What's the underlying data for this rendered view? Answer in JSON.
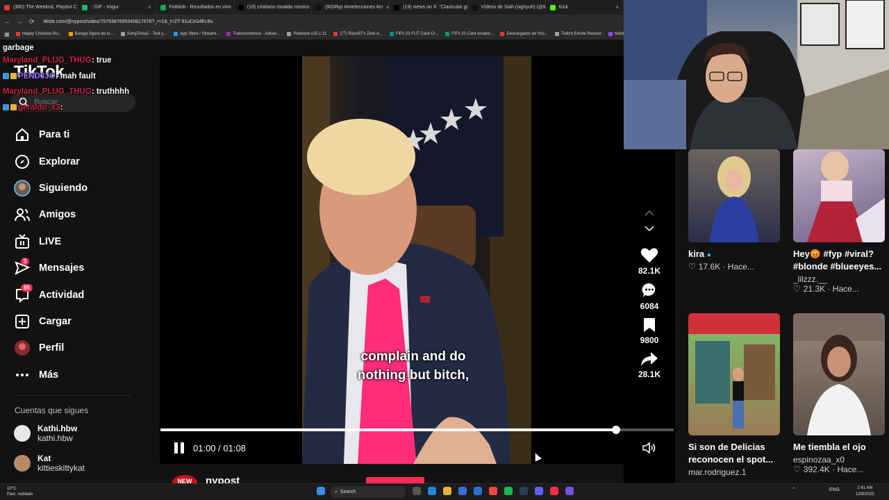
{
  "browser": {
    "tabs": [
      {
        "label": "(380) The Weeknd, Playboi Ca",
        "color": "#e53935"
      },
      {
        "label": "- GIF - Imgur",
        "color": "#1bb76e"
      },
      {
        "label": "FotMob - Resultados en vivo",
        "color": "#00b050"
      },
      {
        "label": "(19) cristiano ronaldo mexico",
        "color": "#000000"
      },
      {
        "label": "(90)#fyp #mielecciones #cr",
        "color": "#111111"
      },
      {
        "label": "(19) views on X: \"Clavicular gi",
        "color": "#000000"
      },
      {
        "label": "Vídeos de Siah (sighyuh) (@ti",
        "color": "#111111"
      },
      {
        "label": "Kick",
        "color": "#53fc18"
      }
    ],
    "url": "tiktok.com/@nypost/video/7579387695340817678?_r=1&_t=ZT-91uCkS4Ec9u",
    "bookmarks": [
      {
        "label": "Happy Cristiano Ro...",
        "color": "#e53935"
      },
      {
        "label": "Burago figura de to...",
        "color": "#ff9800"
      },
      {
        "label": "SongTrivia2 - Test y...",
        "color": "#9e9e9e"
      },
      {
        "label": "App Store / Streami...",
        "color": "#2196f3"
      },
      {
        "label": "Transcendence - Advan...",
        "color": "#9c27b0"
      },
      {
        "label": "Peletoob v25.1.11",
        "color": "#9e9e9e"
      },
      {
        "label": "(77) Razo97's Zest-A...",
        "color": "#e53935"
      },
      {
        "label": "FIFA 23 FUT Card Cr...",
        "color": "#009688"
      },
      {
        "label": "FIFA 23 Card creator...",
        "color": "#009688"
      },
      {
        "label": "Descargador de You...",
        "color": "#e53935"
      },
      {
        "label": "Twitch Emote Resizer",
        "color": "#9e9e9e"
      },
      {
        "label": "twitch em",
        "color": "#9146ff"
      }
    ]
  },
  "chat": {
    "lines": [
      {
        "user": "garbage",
        "message": "",
        "user_color": "#ffffff"
      },
      {
        "user": "Maryland_PLUG_THUG",
        "message": " : true",
        "user_color": "#d0204a"
      },
      {
        "user": "PEND3JO",
        "message": " : mah fault",
        "user_color": "#9b6cff"
      },
      {
        "user": "Maryland_PLUG_THUG",
        "message": " : truthhhh",
        "user_color": "#d0204a"
      },
      {
        "user": "geraldo_x3",
        "message": " : ",
        "user_color": "#d0204a"
      }
    ]
  },
  "sidebar": {
    "logo": "TikTok",
    "search_placeholder": "Buscar",
    "items": [
      {
        "label": "Para ti",
        "icon": "home-icon"
      },
      {
        "label": "Explorar",
        "icon": "compass-icon"
      },
      {
        "label": "Siguiendo",
        "icon": "following-avatar-icon"
      },
      {
        "label": "Amigos",
        "icon": "friends-icon"
      },
      {
        "label": "LIVE",
        "icon": "live-icon"
      },
      {
        "label": "Mensajes",
        "icon": "messages-icon",
        "badge": "5"
      },
      {
        "label": "Actividad",
        "icon": "activity-icon",
        "badge": "85"
      },
      {
        "label": "Cargar",
        "icon": "upload-icon"
      },
      {
        "label": "Perfil",
        "icon": "profile-avatar-icon"
      },
      {
        "label": "Más",
        "icon": "more-icon"
      }
    ],
    "following_title": "Cuentas que sigues",
    "following": [
      {
        "name": "Kathi.hbw",
        "handle": "kathi.hbw"
      },
      {
        "name": "Kat",
        "handle": "kittieskittykat"
      }
    ]
  },
  "video": {
    "subtitle_line1": "complain and do",
    "subtitle_line2": "nothing but bitch,",
    "time": "01:00 / 01:08",
    "progress": 0.888,
    "author": "nypost",
    "new_badge": "NEW"
  },
  "actions": {
    "likes": "82.1K",
    "comments": "6084",
    "saves": "9800",
    "shares": "28.1K"
  },
  "suggested": [
    {
      "title": "kira",
      "verified": true,
      "meta": "17.6K",
      "meta2": "Hace...",
      "user": ""
    },
    {
      "title": "Hey😡 #fyp #viral? #blonde #blueeyes...",
      "meta": "21.3K",
      "meta2": "Hace...",
      "user": "_lilzzz.__"
    },
    {
      "title": "Si son de Delicias reconocen el spot...",
      "meta": "",
      "meta2": "",
      "user": "mar.rodriguez.1"
    },
    {
      "title": "Me tiembla el ojo",
      "meta": "392.4K",
      "meta2": "Hace...",
      "user": "espinozaa_x0"
    }
  ],
  "taskbar": {
    "weather_temp": "10°C",
    "weather_desc": "Parc. nublado",
    "search": "Search",
    "lang": "ENG",
    "time": "2:41 AM",
    "date": "12/8/2025"
  }
}
